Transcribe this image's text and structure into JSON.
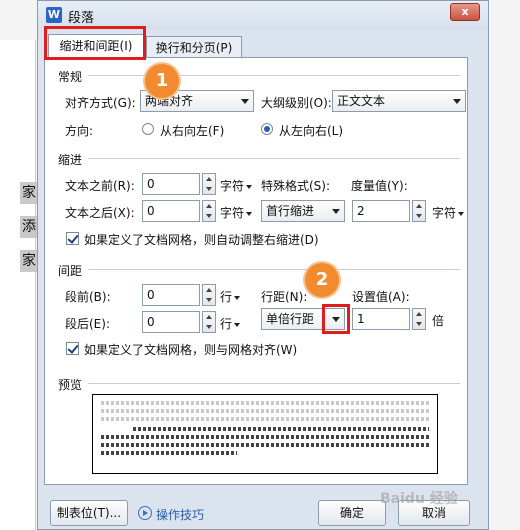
{
  "background": {
    "chars": [
      "家",
      "添",
      "家"
    ]
  },
  "dialog": {
    "app_icon": "W",
    "title": "段落",
    "close": "x"
  },
  "tabs": [
    {
      "label": "缩进和间距(I)",
      "active": true
    },
    {
      "label": "换行和分页(P)",
      "active": false
    }
  ],
  "general": {
    "title": "常规",
    "alignment_label": "对齐方式(G):",
    "alignment_value": "两端对齐",
    "outline_label": "大纲级别(O):",
    "outline_value": "正文文本",
    "direction_label": "方向:",
    "rtl_label": "从右向左(F)",
    "ltr_label": "从左向右(L)",
    "selected_direction": "ltr"
  },
  "indent": {
    "title": "缩进",
    "before_label": "文本之前(R):",
    "before_value": "0",
    "before_unit": "字符",
    "after_label": "文本之后(X):",
    "after_value": "0",
    "after_unit": "字符",
    "special_label": "特殊格式(S):",
    "special_value": "首行缩进",
    "measure_label": "度量值(Y):",
    "measure_value": "2",
    "measure_unit": "字符",
    "grid_check_label": "如果定义了文档网格，则自动调整右缩进(D)",
    "grid_checked": true
  },
  "spacing": {
    "title": "间距",
    "before_label": "段前(B):",
    "before_value": "0",
    "before_unit": "行",
    "after_label": "段后(E):",
    "after_value": "0",
    "after_unit": "行",
    "line_label": "行距(N):",
    "line_value": "单倍行距",
    "setting_label": "设置值(A):",
    "setting_value": "1",
    "setting_unit": "倍",
    "grid_check_label": "如果定义了文档网格，则与网格对齐(W)",
    "grid_checked": true
  },
  "preview": {
    "title": "预览"
  },
  "footer": {
    "tabs_button": "制表位(T)...",
    "tips_link": "操作技巧",
    "ok": "确定",
    "cancel": "取消"
  },
  "callouts": [
    "1",
    "2"
  ],
  "watermark": "Baidu 经验",
  "colors": {
    "highlight": "#e01d1d",
    "callout": "#f28b30",
    "accent": "#2a5bb5"
  }
}
